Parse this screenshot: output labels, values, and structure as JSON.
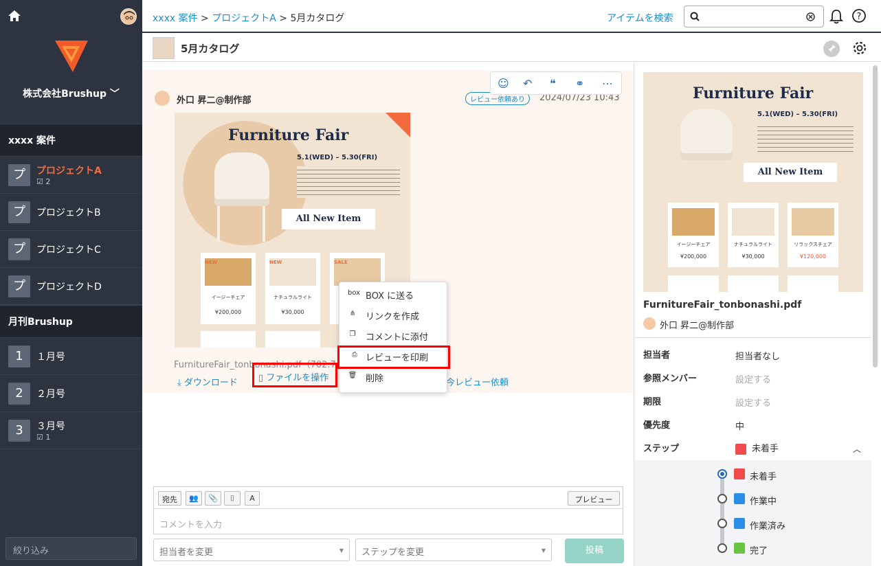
{
  "sidebar": {
    "company": "株式会社Brushup ﹀",
    "section1": "xxxx 案件",
    "projects": [
      {
        "badge": "プ",
        "label": "プロジェクトA",
        "sub": "☑ 2"
      },
      {
        "badge": "プ",
        "label": "プロジェクトB",
        "sub": ""
      },
      {
        "badge": "プ",
        "label": "プロジェクトC",
        "sub": ""
      },
      {
        "badge": "プ",
        "label": "プロジェクトD",
        "sub": ""
      }
    ],
    "section2": "月刊Brushup",
    "issues": [
      {
        "badge": "1",
        "label": "１月号",
        "sub": ""
      },
      {
        "badge": "2",
        "label": "２月号",
        "sub": ""
      },
      {
        "badge": "3",
        "label": "３月号",
        "sub": "☑ 1"
      }
    ],
    "filter_placeholder": "絞り込み"
  },
  "header": {
    "crumb1": "xxxx 案件",
    "sep1": " > ",
    "crumb2": "プロジェクトA",
    "sep2": " > ",
    "crumb3": "5月カタログ",
    "search_link": "アイテムを検索"
  },
  "subbar": {
    "title": "5月カタログ"
  },
  "post": {
    "author": "外口 昇二@制作部",
    "badge": "レビュー依頼あり",
    "date": "2024/07/23 10:43",
    "file_name": "FurnitureFair_tonbonashi.pdf（702.7",
    "download": "⤓ ダウンロード",
    "file_op": "ファイルを操作",
    "review_request": "今レビュー依頼"
  },
  "image": {
    "title": "Furniture Fair",
    "dates": "5.1(WED) – 5.30(FRI)",
    "banner": "All New Item",
    "cards": [
      {
        "tag": "NEW",
        "name": "イージーチェア",
        "price": "¥200,000"
      },
      {
        "tag": "NEW",
        "name": "ナチュラルライト",
        "price": "¥30,000"
      },
      {
        "tag": "SALE",
        "name": "リラックスチェア",
        "price": "¥120,000"
      }
    ]
  },
  "menu": {
    "items": [
      {
        "icon": "box",
        "label": "BOX に送る"
      },
      {
        "icon": "⋔",
        "label": "リンクを作成"
      },
      {
        "icon": "❐",
        "label": "コメントに添付"
      },
      {
        "icon": "⎙",
        "label": "レビューを印刷"
      },
      {
        "icon": "🗑",
        "label": "削除"
      }
    ]
  },
  "composer": {
    "tool1": "宛先",
    "tool_text": "A",
    "preview": "プレビュー",
    "placeholder": "コメントを入力",
    "assignee_select": "担当者を変更",
    "step_select": "ステップを変更",
    "submit": "投稿"
  },
  "right": {
    "file": "FurnitureFair_tonbonashi.pdf",
    "author": "外口 昇二@制作部",
    "props": [
      {
        "label": "担当者",
        "value": "担当者なし"
      },
      {
        "label": "参照メンバー",
        "value": "設定する"
      },
      {
        "label": "期限",
        "value": "設定する"
      },
      {
        "label": "優先度",
        "value": "中"
      },
      {
        "label": "ステップ",
        "value": "未着手"
      }
    ],
    "steps": [
      {
        "label": "未着手",
        "color": "#f24b4b",
        "selected": true
      },
      {
        "label": "作業中",
        "color": "#2b8fe8",
        "selected": false
      },
      {
        "label": "作業済み",
        "color": "#2b8fe8",
        "selected": false
      },
      {
        "label": "完了",
        "color": "#6bc441",
        "selected": false
      }
    ]
  },
  "colors": {
    "accent": "#1a8fc9",
    "sidebar": "#2d3440",
    "active": "#f36c3f",
    "highlight": "#ff0000"
  }
}
